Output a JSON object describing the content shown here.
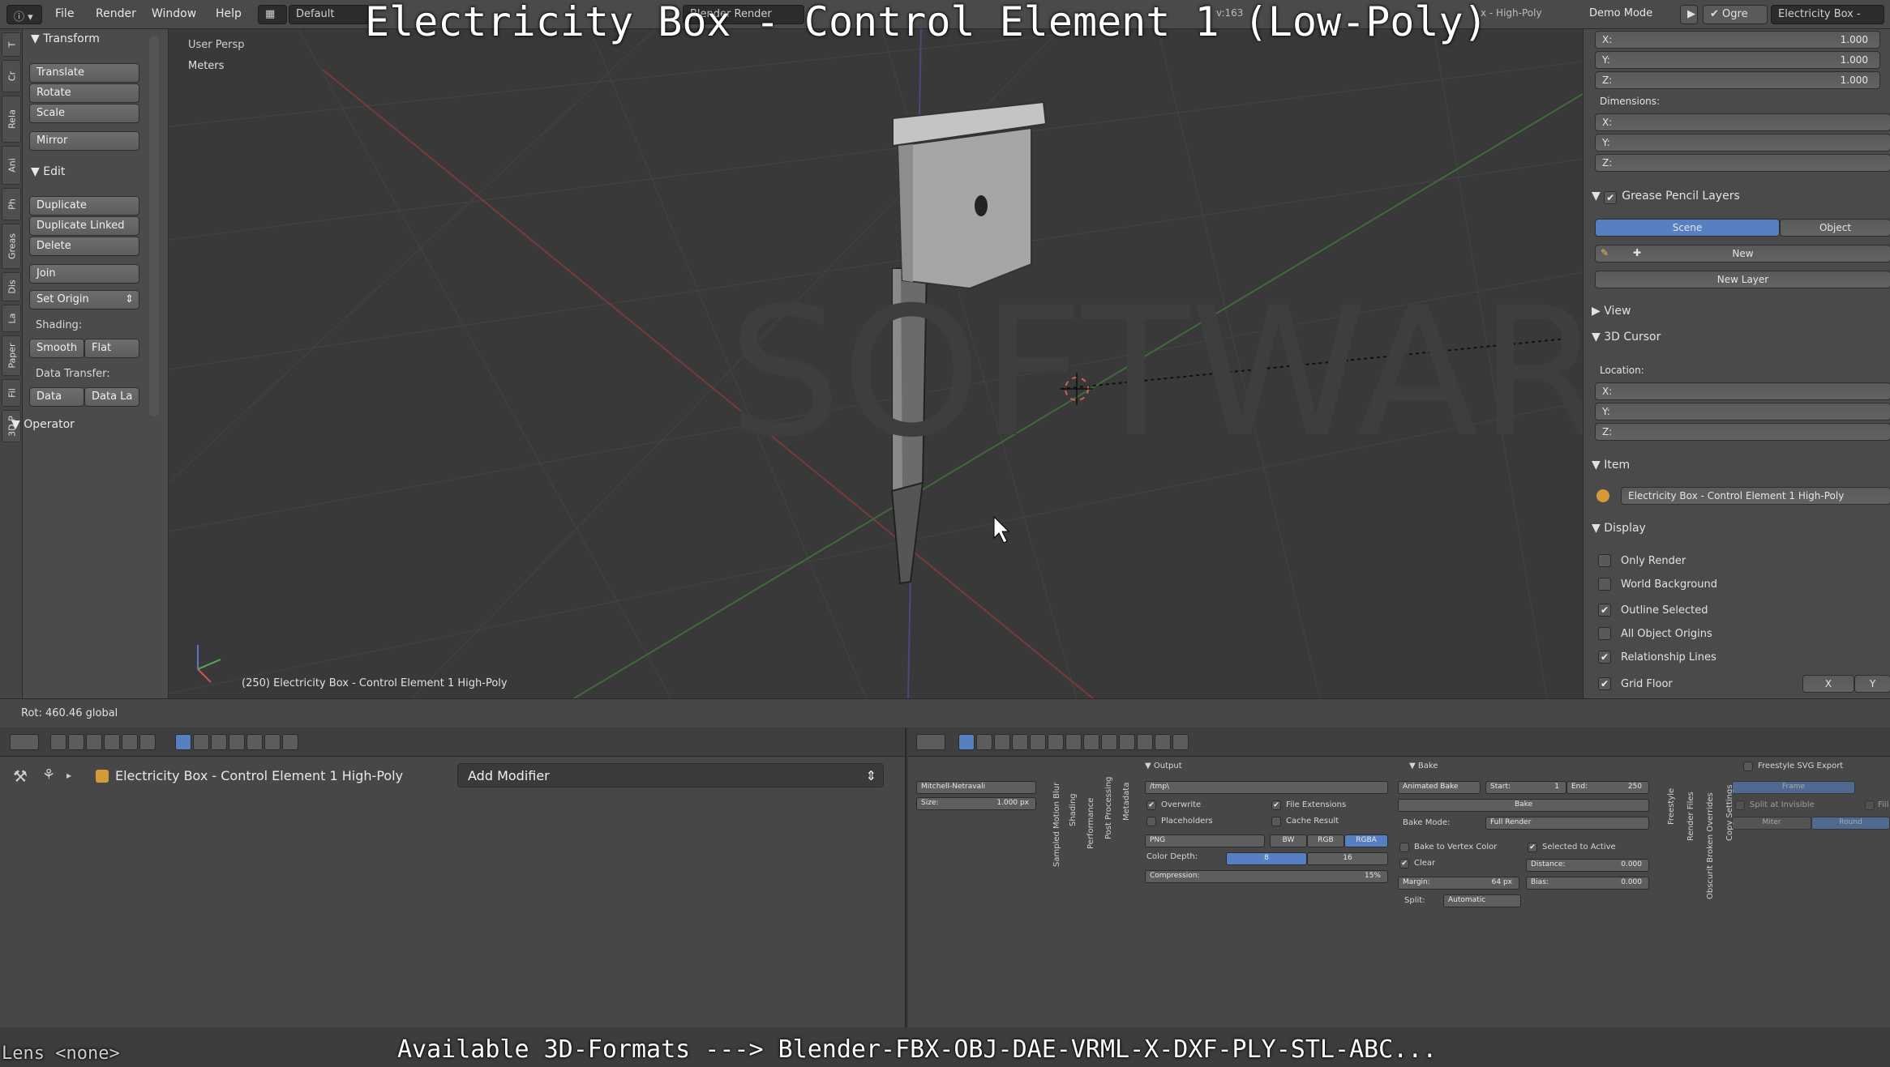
{
  "overlay": {
    "title": "Electricity Box - Control Element 1 (Low-Poly)",
    "formats": "Available 3D-Formats ---> Blender-FBX-OBJ-DAE-VRML-X-DXF-PLY-STL-ABC...",
    "lens": "Lens <none>"
  },
  "topbar": {
    "menus": [
      "File",
      "Render",
      "Window",
      "Help"
    ],
    "layout": "Default",
    "engine": "Blender Render",
    "stats_fragment": "v:163",
    "scene_fragment": "x - High-Poly",
    "mode": "Demo Mode",
    "ogre": "Ogre",
    "scene_name": "Electricity Box - "
  },
  "tooltabs": [
    "T",
    "Cr",
    "Rela",
    "Ani",
    "Ph",
    "Greas",
    "Dis",
    "La",
    "Paper",
    "Fil",
    "3D P"
  ],
  "toolshelf": {
    "transform_header": "Transform",
    "translate": "Translate",
    "rotate": "Rotate",
    "scale": "Scale",
    "mirror": "Mirror",
    "edit_header": "Edit",
    "duplicate": "Duplicate",
    "duplicate_linked": "Duplicate Linked",
    "delete": "Delete",
    "join": "Join",
    "set_origin": "Set Origin",
    "shading_label": "Shading:",
    "smooth": "Smooth",
    "flat": "Flat",
    "data_transfer_label": "Data Transfer:",
    "data": "Data",
    "data_la": "Data La",
    "operator_header": "Operator"
  },
  "viewport": {
    "view_name": "User Persp",
    "units": "Meters",
    "object_info": "(250) Electricity Box - Control Element 1 High-Poly",
    "watermark": "SOFTWARE"
  },
  "status": {
    "rot": "Rot: 460.46 global"
  },
  "properties": {
    "scale": [
      {
        "axis": "X:",
        "value": "1.000"
      },
      {
        "axis": "Y:",
        "value": "1.000"
      },
      {
        "axis": "Z:",
        "value": "1.000"
      }
    ],
    "dimensions_label": "Dimensions:",
    "dimensions": [
      "X:",
      "Y:",
      "Z:"
    ],
    "grease_header": "Grease Pencil Layers",
    "scene_tab": "Scene",
    "object_tab": "Object",
    "new": "New",
    "new_layer": "New Layer",
    "view_header": "View",
    "cursor_header": "3D Cursor",
    "location_label": "Location:",
    "location": [
      "X:",
      "Y:",
      "Z:"
    ],
    "item_header": "Item",
    "item_name": "Electricity Box - Control Element 1 High-Poly",
    "display_header": "Display",
    "display_options": [
      {
        "label": "Only Render",
        "checked": false
      },
      {
        "label": "World Background",
        "checked": false
      },
      {
        "label": "Outline Selected",
        "checked": true
      },
      {
        "label": "All Object Origins",
        "checked": false
      },
      {
        "label": "Relationship Lines",
        "checked": true
      },
      {
        "label": "Grid Floor",
        "checked": true
      }
    ],
    "grid_x": "X",
    "grid_y": "Y"
  },
  "modifiers": {
    "object_name": "Electricity Box - Control Element 1 High-Poly",
    "add_modifier": "Add Modifier"
  },
  "render": {
    "filter": "Mitchell-Netravali",
    "size_label": "Size:",
    "size_value": "1.000 px",
    "vertical_tabs_1": [
      "Sampled Motion Blur",
      "Shading",
      "Performance",
      "Post Processing",
      "Metadata"
    ],
    "output_header": "Output",
    "output_path": "/tmp\\",
    "overwrite": "Overwrite",
    "file_extensions": "File Extensions",
    "placeholders": "Placeholders",
    "cache_result": "Cache Result",
    "format": "PNG",
    "bw": "BW",
    "rgb": "RGB",
    "rgba": "RGBA",
    "color_depth_label": "Color Depth:",
    "depth_8": "8",
    "depth_16": "16",
    "compression": "Compression:",
    "compression_value": "15%",
    "bake_header": "Bake",
    "animated_bake": "Animated Bake",
    "start": "Start:",
    "start_value": "1",
    "end": "End:",
    "end_value": "250",
    "bake_button": "Bake",
    "bake_mode_label": "Bake Mode:",
    "bake_mode": "Full Render",
    "bake_vertex": "Bake to Vertex Color",
    "selected_active": "Selected to Active",
    "clear": "Clear",
    "distance": "Distance:",
    "distance_value": "0.000",
    "margin": "Margin:",
    "margin_value": "64 px",
    "bias": "Bias:",
    "bias_value": "0.000",
    "split": "Split:",
    "split_value": "Automatic",
    "vertical_tabs_2": [
      "Freestyle",
      "Render Files",
      "Obscurit Broken Overrides",
      "Copy Settings"
    ],
    "freestyle_svg": "Freestyle SVG Export",
    "frame": "Frame",
    "split_invisible": "Split at Invisible",
    "fill": "Fill",
    "miter": "Miter",
    "round": "Round"
  }
}
